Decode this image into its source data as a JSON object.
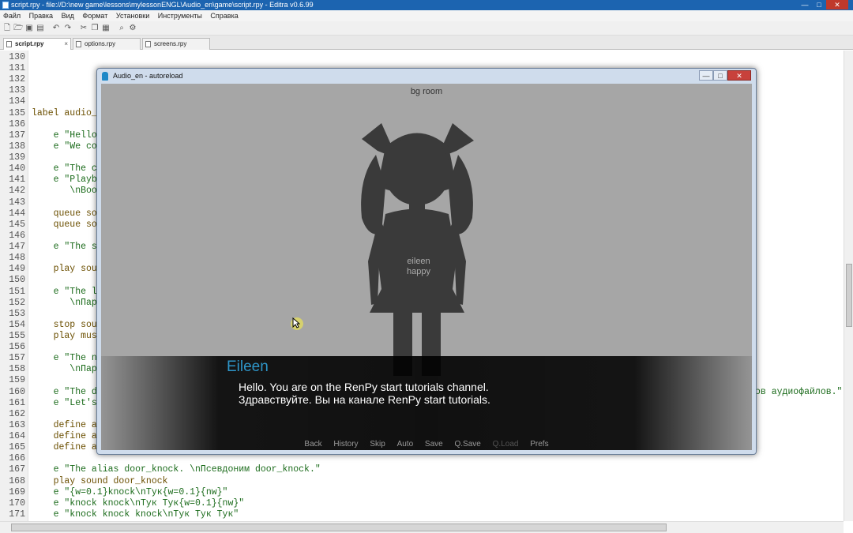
{
  "window": {
    "title": "script.rpy - file://D:\\new game\\lessons\\mylessonENGL\\Audio_en\\game\\script.rpy - Editra v0.6.99",
    "buttons": [
      "—",
      "□",
      "✕"
    ]
  },
  "menu": [
    "Файл",
    "Правка",
    "Вид",
    "Формат",
    "Установки",
    "Инструменты",
    "Справка"
  ],
  "tabs": [
    {
      "label": "script.rpy",
      "active": true,
      "close": "×"
    },
    {
      "label": "options.rpy",
      "active": false
    },
    {
      "label": "screens.rpy",
      "active": false
    }
  ],
  "editor": {
    "line_numbers": [
      "130",
      "131",
      "132",
      "133",
      "134",
      "135",
      "136",
      "137",
      "138",
      "139",
      "140",
      "141",
      "142",
      "143",
      "144",
      "145",
      "146",
      "147",
      "148",
      "149",
      "150",
      "151",
      "152",
      "153",
      "154",
      "155",
      "156",
      "157",
      "158",
      "159",
      "160",
      "161",
      "162",
      "163",
      "164",
      "165",
      "166",
      "167",
      "168",
      "169",
      "170",
      "171"
    ],
    "lines": [
      "",
      "",
      "",
      "",
      "",
      "label audio_",
      "",
      "    e \"Hello",
      "    e \"We co",
      "",
      "    e \"The c",
      "    e \"Playb",
      "       \\nBoo",
      "",
      "    queue so",
      "    queue so",
      "",
      "    e \"The s",
      "",
      "    play sou",
      "",
      "    e \"The l",
      "       \\nПар",
      "",
      "    stop sou",
      "    play mus",
      "",
      "    e \"The n",
      "       \\nПар",
      "",
      "    e \"The d",
      "    e \"Let's",
      "",
      "    define a",
      "    define a",
      "    define a",
      "",
      "    e \"The alias door_knock. \\nПсевдоним door_knock.\"",
      "    play sound door_knock",
      "    e \"{w=0.1}knock\\nТук{w=0.1}{nw}\"",
      "    e \"knock knock\\nТук Тук{w=0.1}{nw}\"",
      "    e \"knock knock knock\\nТук Тук Тук\""
    ],
    "overflow_text_line160": "ов аудиофайлов.\""
  },
  "dialog": {
    "title": "Audio_en - autoreload",
    "buttons": [
      "—",
      "□",
      "✕"
    ],
    "scene_label": "bg room",
    "sprite_label": [
      "eileen",
      "happy"
    ],
    "speaker": "Eileen",
    "dialogue": [
      "Hello. You are on the RenPy start tutorials channel.",
      "Здравствуйте. Вы на канале RenPy start tutorials."
    ],
    "quick_menu": [
      {
        "label": "Back",
        "enabled": true
      },
      {
        "label": "History",
        "enabled": true
      },
      {
        "label": "Skip",
        "enabled": true
      },
      {
        "label": "Auto",
        "enabled": true
      },
      {
        "label": "Save",
        "enabled": true
      },
      {
        "label": "Q.Save",
        "enabled": true
      },
      {
        "label": "Q.Load",
        "enabled": false
      },
      {
        "label": "Prefs",
        "enabled": true
      }
    ]
  },
  "colors": {
    "titlebar": "#1c64b0",
    "speaker_name": "#2e95c8",
    "game_bg": "#a6a6a6",
    "keyword": "#7a5c00",
    "string": "#1b6b1b"
  }
}
